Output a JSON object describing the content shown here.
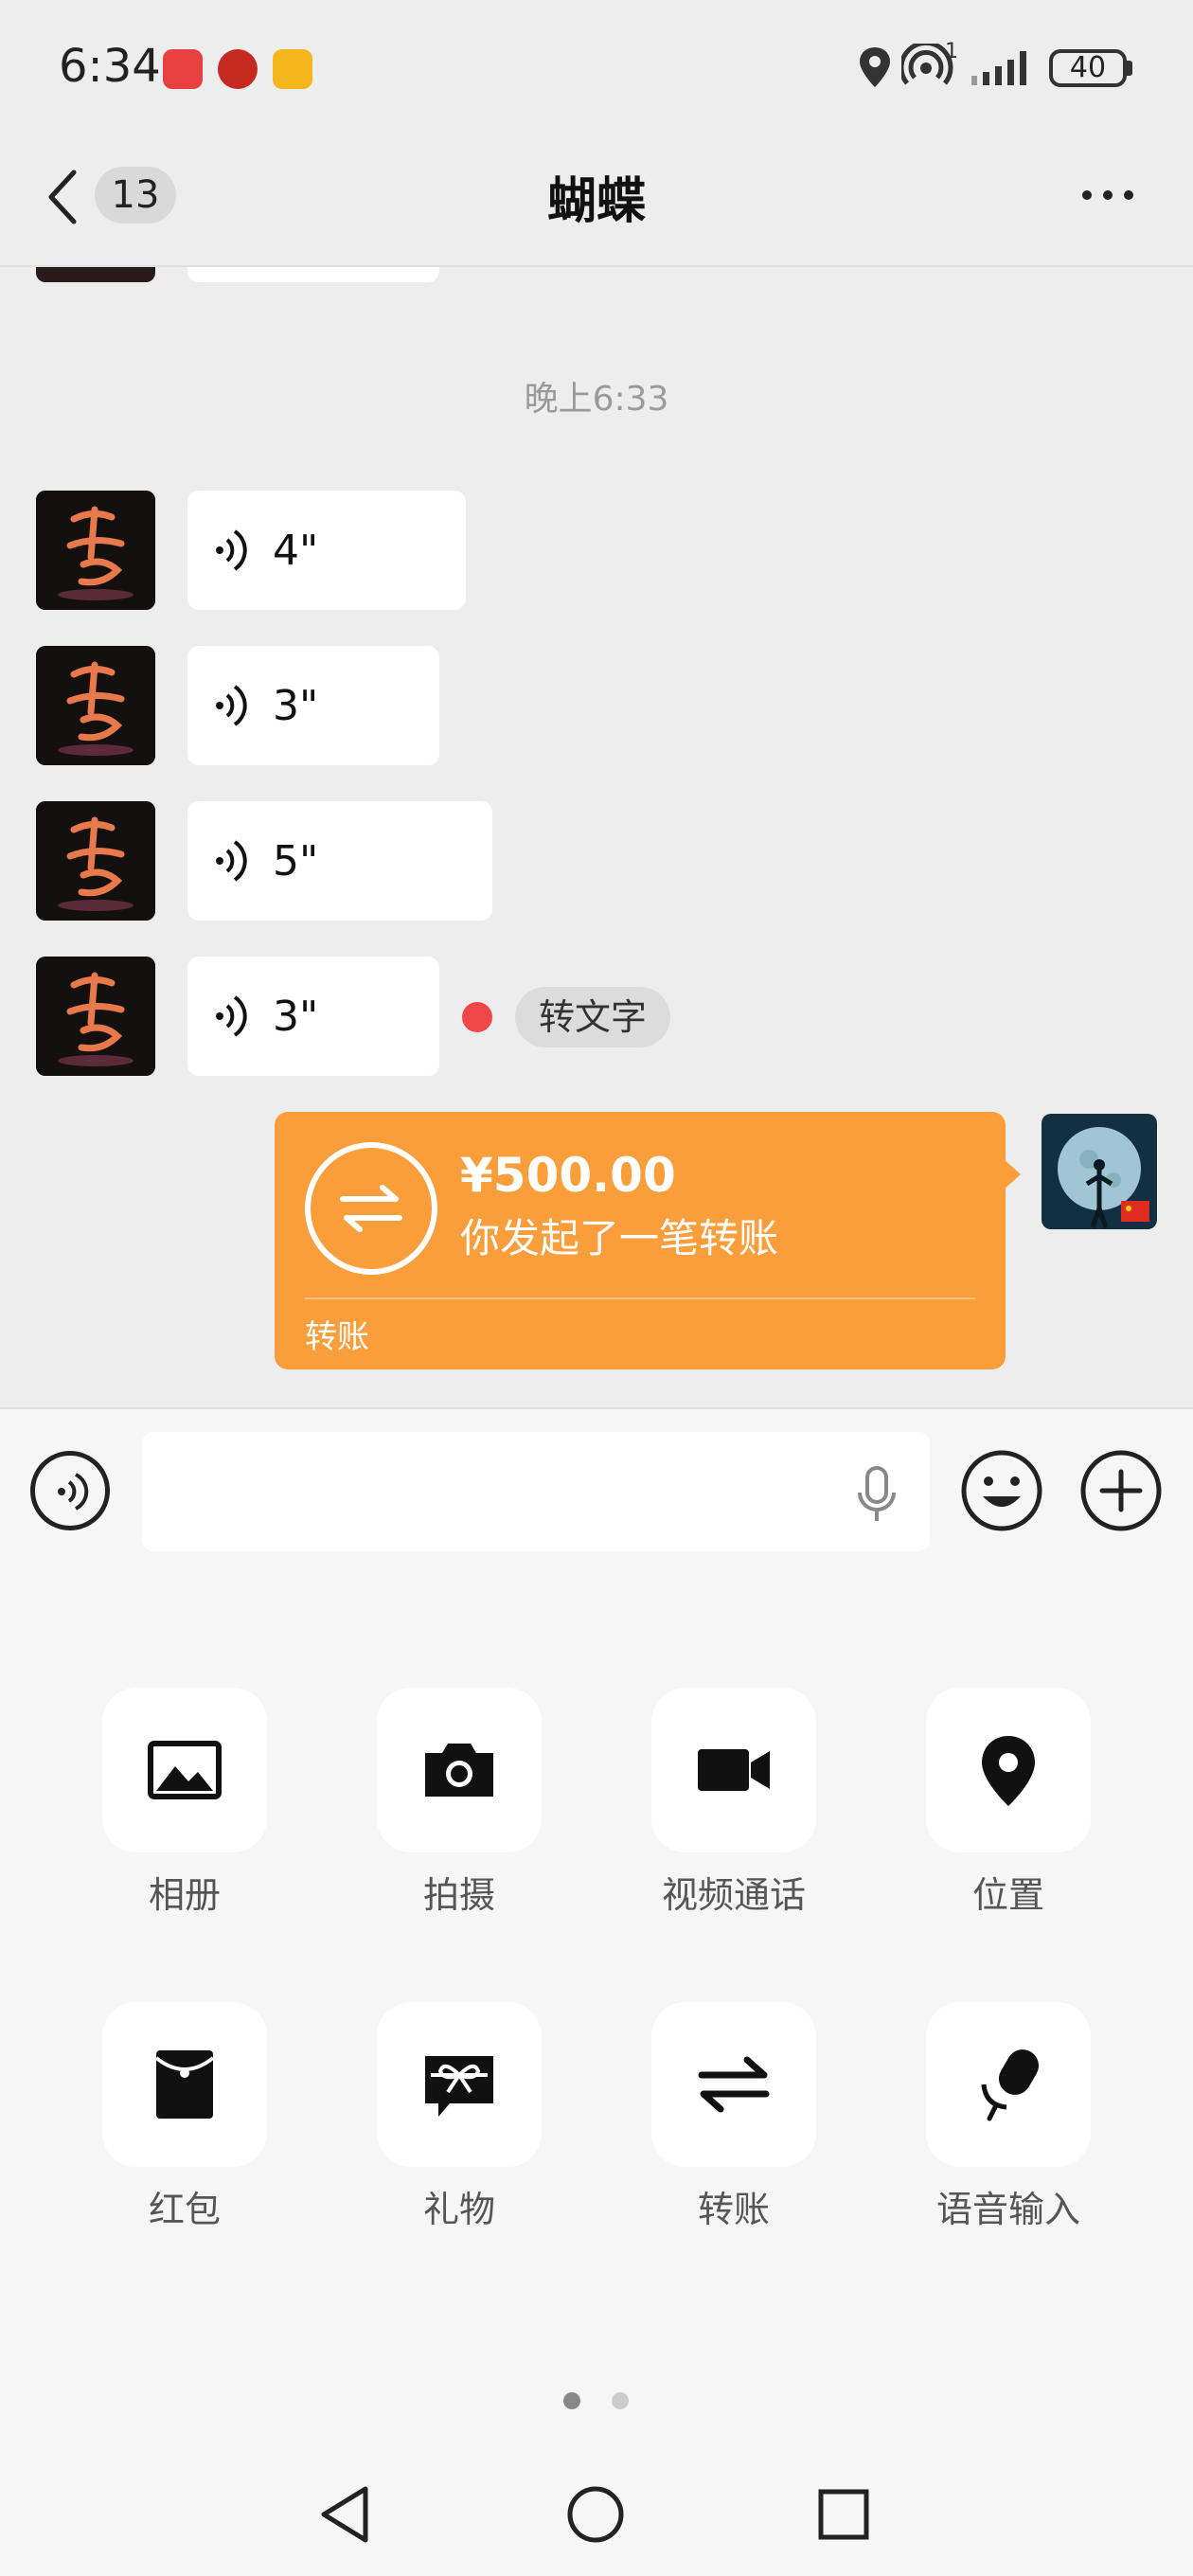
{
  "status_bar": {
    "time": "6:34",
    "battery": "40",
    "signal_sub": "1"
  },
  "header": {
    "unread_count": "13",
    "title": "蝴蝶"
  },
  "chat": {
    "timestamp": "晚上6:33",
    "voice_messages": [
      {
        "duration": "4\""
      },
      {
        "duration": "3\""
      },
      {
        "duration": "5\""
      },
      {
        "duration": "3\""
      }
    ],
    "to_text_label": "转文字",
    "transfer": {
      "amount": "¥500.00",
      "description": "你发起了一笔转账",
      "label": "转账"
    }
  },
  "input": {
    "value": "",
    "placeholder": ""
  },
  "panel": {
    "items": [
      {
        "label": "相册",
        "icon": "photo-album-icon"
      },
      {
        "label": "拍摄",
        "icon": "camera-icon"
      },
      {
        "label": "视频通话",
        "icon": "video-call-icon"
      },
      {
        "label": "位置",
        "icon": "location-icon"
      },
      {
        "label": "红包",
        "icon": "red-packet-icon"
      },
      {
        "label": "礼物",
        "icon": "gift-icon"
      },
      {
        "label": "转账",
        "icon": "transfer-icon"
      },
      {
        "label": "语音输入",
        "icon": "voice-input-icon"
      }
    ],
    "page_count": 2,
    "current_page": 1
  },
  "colors": {
    "chat_bg": "#ededed",
    "transfer_orange": "#fa9d3b",
    "unread_red": "#f04848",
    "panel_bg": "#f6f6f6"
  }
}
